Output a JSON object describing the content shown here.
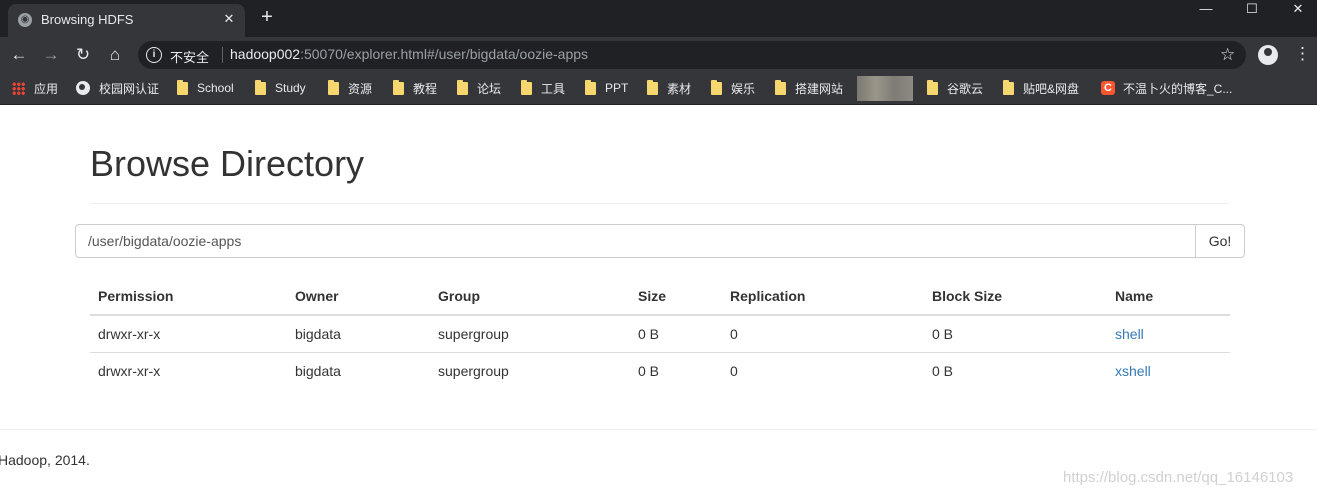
{
  "browser": {
    "tab_title": "Browsing HDFS",
    "new_tab_symbol": "+",
    "insecure_label": "不安全",
    "url_host": "hadoop002",
    "url_rest": ":50070/explorer.html#/user/bigdata/oozie-apps"
  },
  "bookmarks": [
    {
      "label": "应用",
      "icon": "apps-grid-icon"
    },
    {
      "label": "校园网认证",
      "icon": "globe-icon"
    },
    {
      "label": "School",
      "icon": "folder-icon"
    },
    {
      "label": "Study",
      "icon": "folder-icon"
    },
    {
      "label": "资源",
      "icon": "folder-icon"
    },
    {
      "label": "教程",
      "icon": "folder-icon"
    },
    {
      "label": "论坛",
      "icon": "folder-icon"
    },
    {
      "label": "工具",
      "icon": "folder-icon"
    },
    {
      "label": "PPT",
      "icon": "folder-icon"
    },
    {
      "label": "素材",
      "icon": "folder-icon"
    },
    {
      "label": "娱乐",
      "icon": "folder-icon"
    },
    {
      "label": "搭建网站",
      "icon": "folder-icon"
    },
    {
      "label": "谷歌云",
      "icon": "folder-icon"
    },
    {
      "label": "贴吧&网盘",
      "icon": "folder-icon"
    },
    {
      "label": "不温卜火的博客_C...",
      "icon": "csdn-icon"
    }
  ],
  "page": {
    "title": "Browse Directory",
    "path_value": "/user/bigdata/oozie-apps",
    "go_label": "Go!",
    "columns": [
      "Permission",
      "Owner",
      "Group",
      "Size",
      "Replication",
      "Block Size",
      "Name"
    ],
    "rows": [
      {
        "permission": "drwxr-xr-x",
        "owner": "bigdata",
        "group": "supergroup",
        "size": "0 B",
        "replication": "0",
        "block_size": "0 B",
        "name": "shell"
      },
      {
        "permission": "drwxr-xr-x",
        "owner": "bigdata",
        "group": "supergroup",
        "size": "0 B",
        "replication": "0",
        "block_size": "0 B",
        "name": "xshell"
      }
    ],
    "footer": "Hadoop, 2014."
  },
  "watermark": "https://blog.csdn.net/qq_16146103",
  "colors": {
    "link": "#337ab7",
    "chrome_dark": "#202124",
    "chrome_toolbar": "#35363a"
  }
}
